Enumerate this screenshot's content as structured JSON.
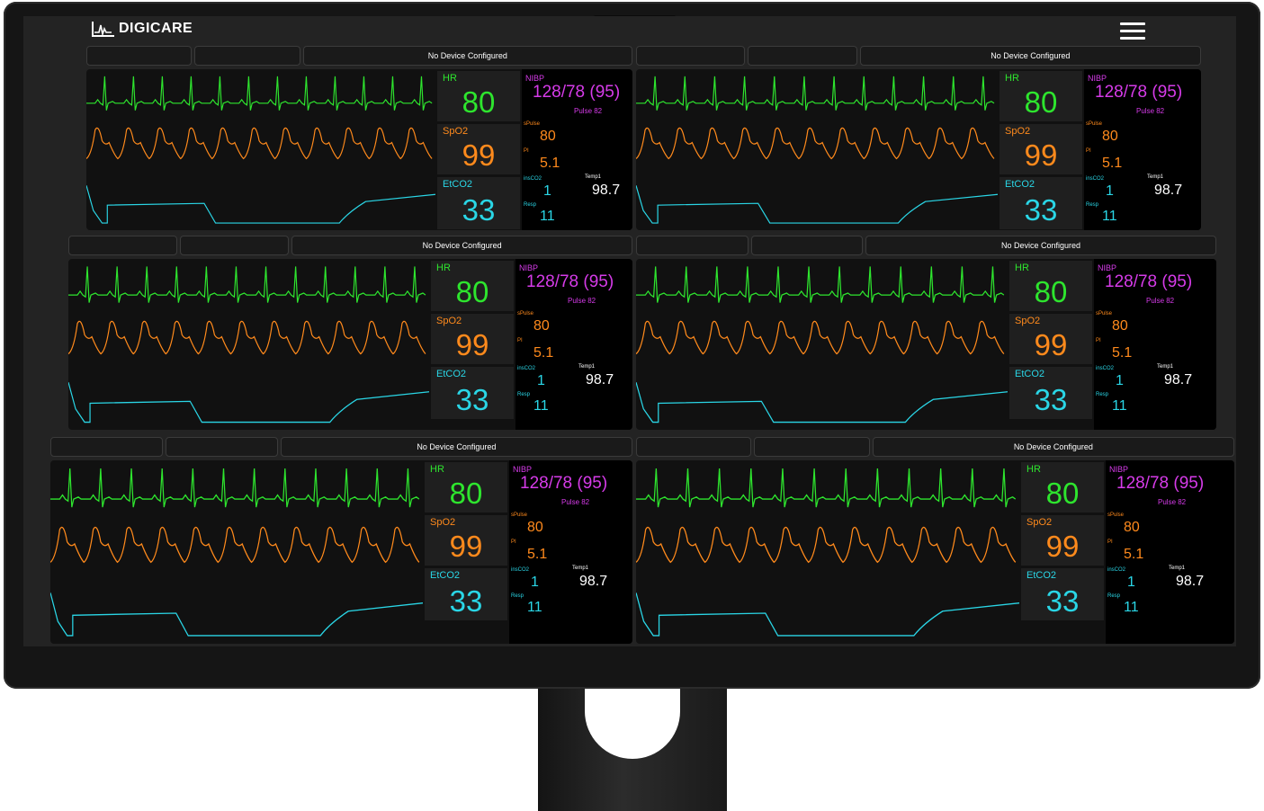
{
  "brand": {
    "name": "DIGICARE"
  },
  "menu_icon": "hamburger-icon",
  "colors": {
    "hr": "#2ee52e",
    "spo2": "#ff8a1c",
    "etco2": "#2ad6e6",
    "nibp": "#d63be9",
    "temp": "#ffffff"
  },
  "panel": {
    "tab_label": "No Device Configured",
    "hr_label": "HR",
    "hr_value": "80",
    "spo2_label": "SpO2",
    "spo2_value": "99",
    "etco2_label": "EtCO2",
    "etco2_value": "33",
    "nibp_label": "NIBP",
    "nibp_value": "128/78 (95)",
    "pulse": "Pulse 82",
    "spulse_label": "sPulse",
    "spulse_value": "80",
    "pi_label": "PI",
    "pi_value": "5.1",
    "insco2_label": "insCO2",
    "insco2_value": "1",
    "temp_label": "Temp1",
    "temp_value": "98.7",
    "resp_label": "Resp",
    "resp_value": "11"
  }
}
